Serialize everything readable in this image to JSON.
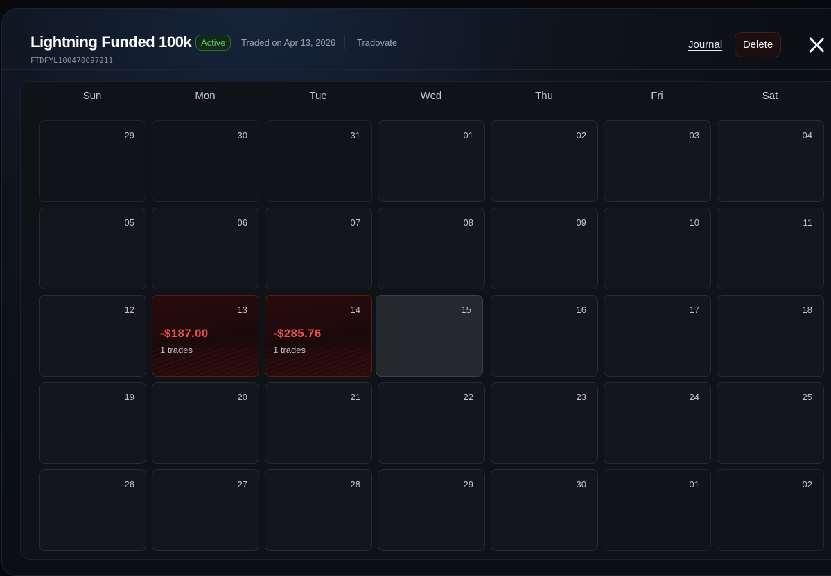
{
  "header": {
    "title": "Lightning Funded 100k",
    "status_badge": "Active",
    "traded_on": "Traded on Apr 13, 2026",
    "platform": "Tradovate",
    "account_id": "FTDFYL100470097211",
    "journal_label": "Journal",
    "delete_label": "Delete"
  },
  "colors": {
    "accent_active": "#59c36a",
    "loss": "#ec5252",
    "background": "#0b0f14"
  },
  "calendar": {
    "weekdays": [
      "Sun",
      "Mon",
      "Tue",
      "Wed",
      "Thu",
      "Fri",
      "Sat"
    ],
    "weeks": [
      [
        {
          "num": "29",
          "other": true
        },
        {
          "num": "30",
          "other": true
        },
        {
          "num": "31",
          "other": true
        },
        {
          "num": "01"
        },
        {
          "num": "02"
        },
        {
          "num": "03"
        },
        {
          "num": "04"
        }
      ],
      [
        {
          "num": "05"
        },
        {
          "num": "06"
        },
        {
          "num": "07"
        },
        {
          "num": "08"
        },
        {
          "num": "09"
        },
        {
          "num": "10"
        },
        {
          "num": "11"
        }
      ],
      [
        {
          "num": "12"
        },
        {
          "num": "13",
          "pnl": "-$187.00",
          "trades": "1 trades",
          "status": "loss"
        },
        {
          "num": "14",
          "pnl": "-$285.76",
          "trades": "1 trades",
          "status": "loss"
        },
        {
          "num": "15",
          "status": "today"
        },
        {
          "num": "16"
        },
        {
          "num": "17"
        },
        {
          "num": "18"
        }
      ],
      [
        {
          "num": "19"
        },
        {
          "num": "20"
        },
        {
          "num": "21"
        },
        {
          "num": "22"
        },
        {
          "num": "23"
        },
        {
          "num": "24"
        },
        {
          "num": "25"
        }
      ],
      [
        {
          "num": "26"
        },
        {
          "num": "27"
        },
        {
          "num": "28"
        },
        {
          "num": "29"
        },
        {
          "num": "30"
        },
        {
          "num": "01",
          "other": true
        },
        {
          "num": "02",
          "other": true
        }
      ]
    ]
  }
}
